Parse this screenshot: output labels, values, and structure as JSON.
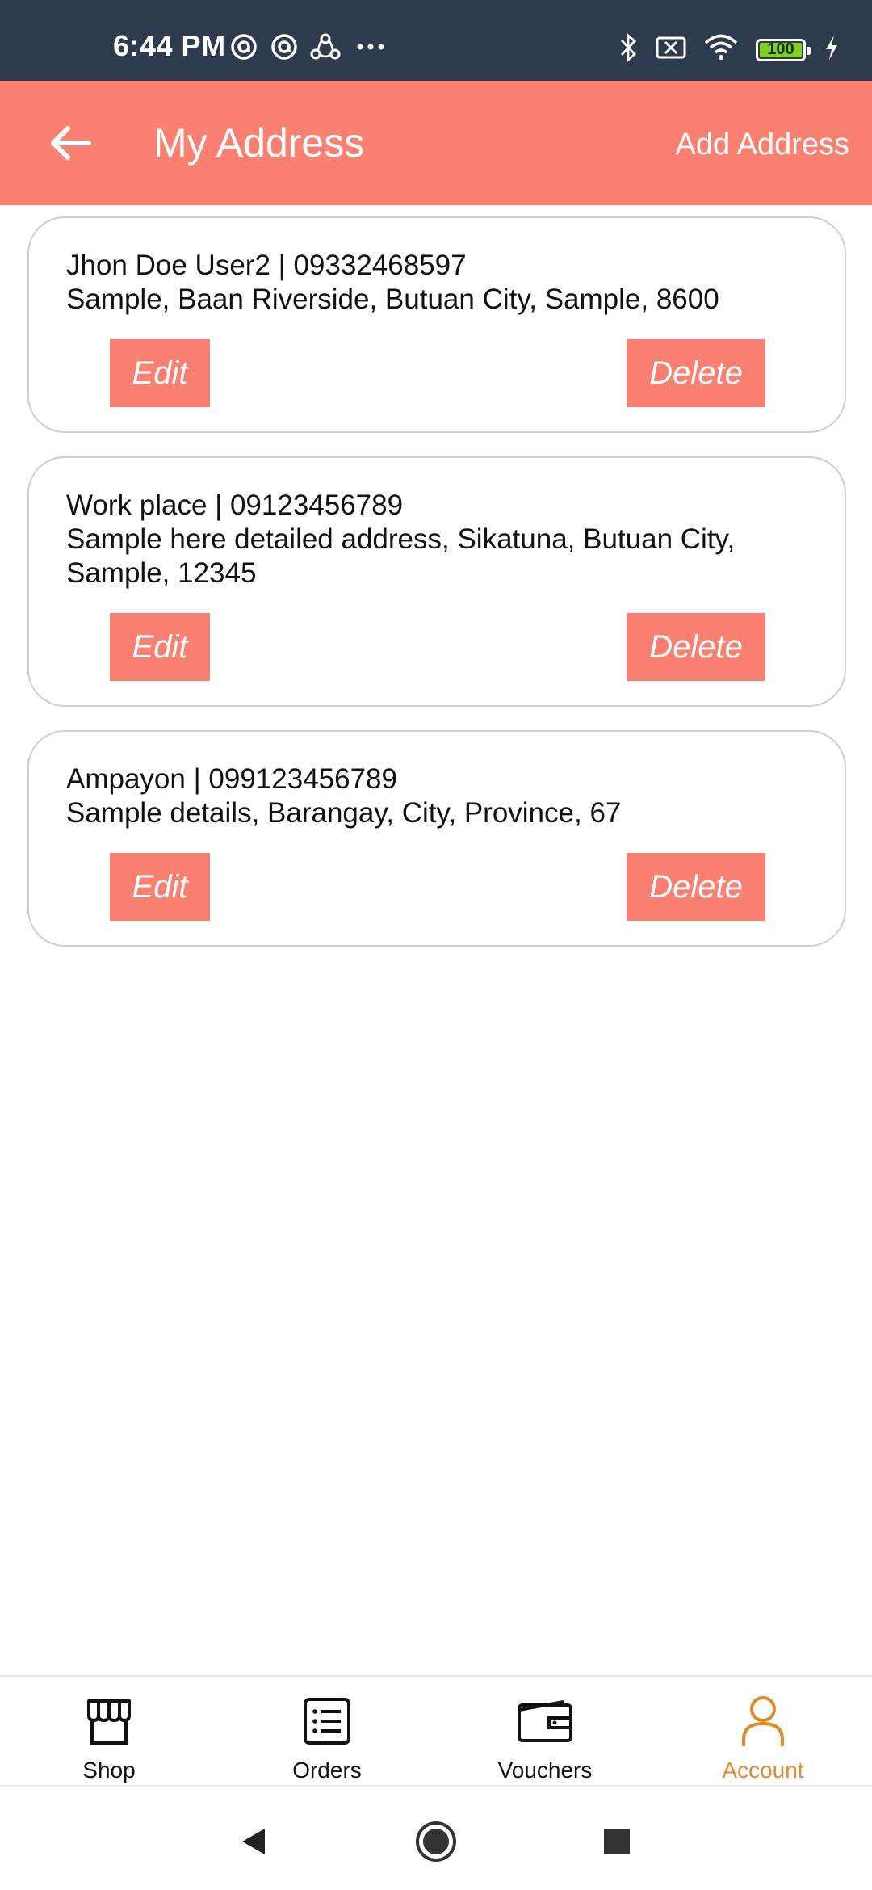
{
  "status_bar": {
    "time": "6:44 PM",
    "left_icons": [
      "at-sign-icon",
      "at-sign-icon",
      "share-icon",
      "more-dots-icon"
    ],
    "right_icons": [
      "bluetooth-icon",
      "no-sim-icon",
      "wifi-icon",
      "battery-icon",
      "charging-icon"
    ],
    "battery_level": "100"
  },
  "app_bar": {
    "back_icon": "arrow-left-icon",
    "title": "My Address",
    "action_label": "Add Address"
  },
  "addresses": [
    {
      "line1": "Jhon Doe User2  | 09332468597",
      "line2": "Sample, Baan Riverside, Butuan City, Sample, 8600",
      "edit_label": "Edit",
      "delete_label": "Delete"
    },
    {
      "line1": "Work place | 09123456789",
      "line2": "Sample here detailed address, Sikatuna, Butuan City, Sample, 12345",
      "edit_label": "Edit",
      "delete_label": "Delete"
    },
    {
      "line1": "Ampayon | 099123456789",
      "line2": "Sample details, Barangay, City, Province, 67",
      "edit_label": "Edit",
      "delete_label": "Delete"
    }
  ],
  "bottom_nav": {
    "items": [
      {
        "label": "Shop",
        "icon": "store-icon"
      },
      {
        "label": "Orders",
        "icon": "list-icon"
      },
      {
        "label": "Vouchers",
        "icon": "wallet-icon"
      },
      {
        "label": "Account",
        "icon": "user-icon",
        "active": true
      }
    ]
  },
  "system_nav": [
    "back-triangle-icon",
    "home-circle-icon",
    "recents-square-icon"
  ],
  "colors": {
    "accent": "#fa8072",
    "status_bar": "#2e3b4e",
    "active_nav": "#e08a2a",
    "battery": "#7ed321"
  }
}
